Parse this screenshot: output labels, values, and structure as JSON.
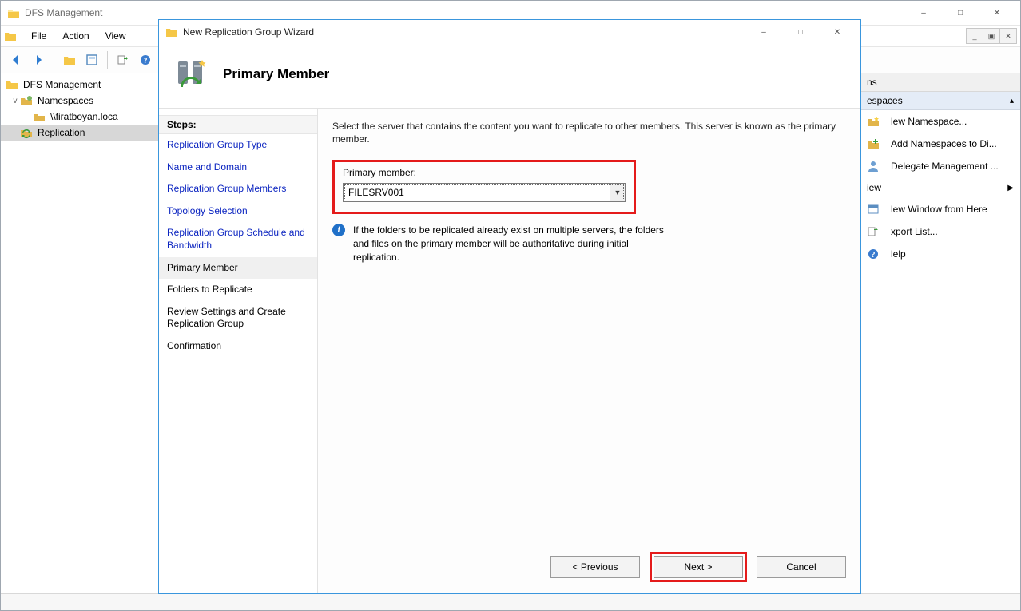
{
  "parent": {
    "title": "DFS Management",
    "menu": [
      "File",
      "Action",
      "View"
    ],
    "tree": {
      "root": "DFS Management",
      "namespaces": "Namespaces",
      "namespace_item": "\\\\firatboyan.loca",
      "replication": "Replication"
    },
    "actions": {
      "header_suffix": "ns",
      "group_title_suffix": "espaces",
      "items": [
        "lew Namespace...",
        "Add Namespaces to Di...",
        "Delegate Management ...",
        "iew",
        "lew Window from Here",
        "xport List...",
        "lelp"
      ]
    }
  },
  "wizard": {
    "title": "New Replication Group Wizard",
    "page_title": "Primary Member",
    "steps_label": "Steps:",
    "steps": [
      "Replication Group Type",
      "Name and Domain",
      "Replication Group Members",
      "Topology Selection",
      "Replication Group Schedule and Bandwidth",
      "Primary Member",
      "Folders to Replicate",
      "Review Settings and Create Replication Group",
      "Confirmation"
    ],
    "current_step_index": 5,
    "description": "Select the server that contains the content you want to replicate to other members. This server is known as the primary member.",
    "primary_member_label": "Primary member:",
    "primary_member_value": "FILESRV001",
    "info_text": "If the folders to be replicated already exist on multiple servers, the folders and files on the primary member will be authoritative during initial replication.",
    "buttons": {
      "previous": "< Previous",
      "next": "Next >",
      "cancel": "Cancel"
    }
  }
}
